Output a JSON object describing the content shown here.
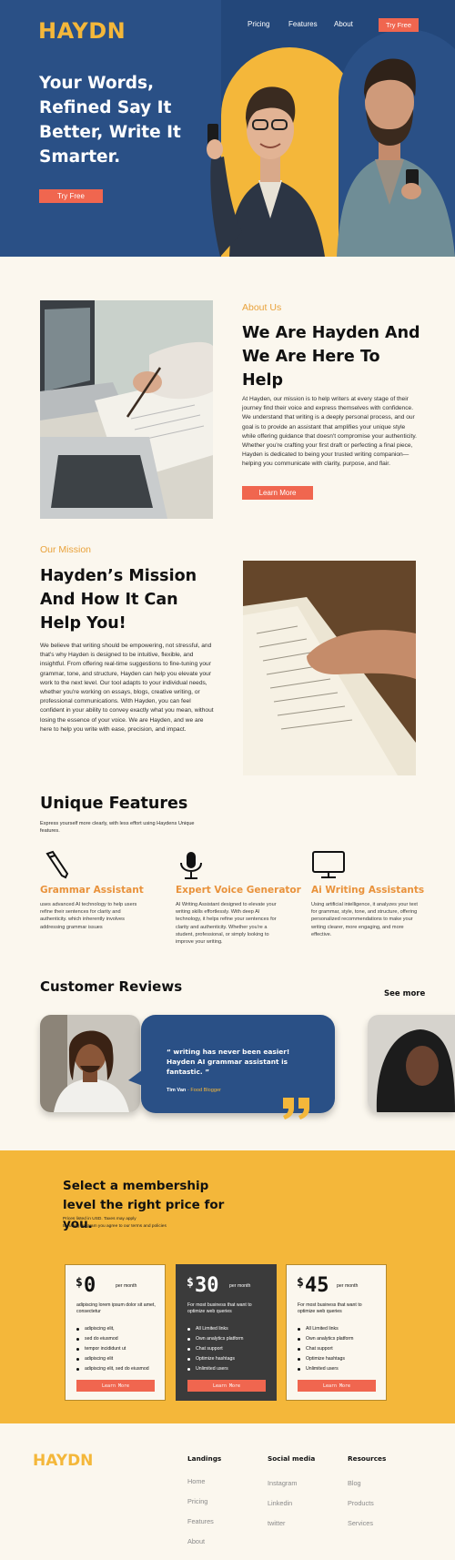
{
  "brand": {
    "logo": "HAYDN",
    "accent": "#f4b73a",
    "primary": "#2a5086",
    "cta": "#f0664f"
  },
  "nav": {
    "items": [
      "Pricing",
      "Features",
      "About"
    ],
    "try_free": "Try Free"
  },
  "hero": {
    "title": "Your Words, Refined Say It Better, Write It Smarter.",
    "cta": "Try Free"
  },
  "about": {
    "kicker": "About Us",
    "title": "We Are Hayden And We Are Here To Help",
    "body": "At Hayden, our mission is to help writers at every stage of their journey find their voice and express themselves with confidence. We understand that writing is a deeply personal process, and our goal is to provide an assistant that amplifies your unique style while offering guidance that doesn't compromise your authenticity. Whether you're crafting your first draft or perfecting a final piece, Hayden is dedicated to being your trusted writing companion—helping you communicate with clarity, purpose, and flair.",
    "cta": "Learn More"
  },
  "mission": {
    "kicker": "Our Mission",
    "title": "Hayden’s Mission And How It Can Help You!",
    "body": "We believe that writing should be empowering, not stressful, and that's why Hayden is designed to be intuitive, flexible, and insightful. From offering real-time suggestions to fine-tuning your grammar, tone, and structure, Hayden can help you elevate your work to the next level. Our tool adapts to your individual needs, whether you're working on essays, blogs, creative writing, or professional communications. With Hayden, you can feel confident in your ability to convey exactly what you mean, without losing the essence of your voice. We are Hayden, and we are here to help you write with ease, precision, and impact."
  },
  "features": {
    "title": "Unique Features",
    "subtitle": "Express yourself more clearly, with less effort using Haydens Unique features.",
    "items": [
      {
        "icon": "pencil-icon",
        "title": "Grammar Assistant",
        "desc": "uses advanced AI technology to help users refine their sentences for clarity and authenticity. which inherently involves addressing grammar issues"
      },
      {
        "icon": "microphone-icon",
        "title": "Expert Voice Generator",
        "desc": "AI Writing Assistant designed to elevate your writing skills effortlessly. With deep AI technology, it helps refine your sentences for clarity and authenticity. Whether you're a student, professional, or simply looking to improve your writing."
      },
      {
        "icon": "monitor-icon",
        "title": "Ai Writing Assistants",
        "desc": "Using artificial intelligence, it analyzes your text for grammar, style, tone, and structure, offering personalized recommendations to make your writing clearer, more engaging, and more effective."
      }
    ]
  },
  "reviews": {
    "title": "Customer Reviews",
    "see_more": "See more",
    "quote": "“ writing has never been easier! Hayden AI grammar assistant  is fantastic. ”",
    "author": "Tim Van",
    "role": "- Food Blogger"
  },
  "pricing": {
    "title": "Select a membership level the right price for you.",
    "note1": "Prices listed in USD. Taxes may apply",
    "note2": "By using program you agree to our terms and policies",
    "plans": [
      {
        "currency": "$",
        "amount": "0",
        "per": "per month",
        "desc": "adipiscing lorem ipsum dolor sit amet, consectetur",
        "features": [
          "adipiscing elit,",
          "sed do eiusmod",
          "tempor incididunt ut",
          "adipiscing elit",
          "adipiscing elit, sed do eiusmod"
        ],
        "cta": "Learn More"
      },
      {
        "currency": "$",
        "amount": "30",
        "per": "per month",
        "desc": "For most business that want to optimize web queries",
        "features": [
          "All Limited links",
          "Own analytics platform",
          "Chat support",
          "Optimize hashtags",
          "Unlimited users"
        ],
        "cta": "Learn More"
      },
      {
        "currency": "$",
        "amount": "45",
        "per": "per month",
        "desc": "For most business that want to optimize web queries",
        "features": [
          "All Limited links",
          "Own analytics platform",
          "Chat support",
          "Optimize hashtags",
          "Unlimited users"
        ],
        "cta": "Learn More"
      }
    ]
  },
  "footer": {
    "logo": "HAYDN",
    "columns": [
      {
        "title": "Landings",
        "links": [
          "Home",
          "Pricing",
          "Features",
          "About"
        ]
      },
      {
        "title": "Social media",
        "links": [
          "Instagram",
          "Linkedin",
          "twitter"
        ]
      },
      {
        "title": "Resources",
        "links": [
          "Blog",
          "Products",
          "Services"
        ]
      }
    ]
  }
}
